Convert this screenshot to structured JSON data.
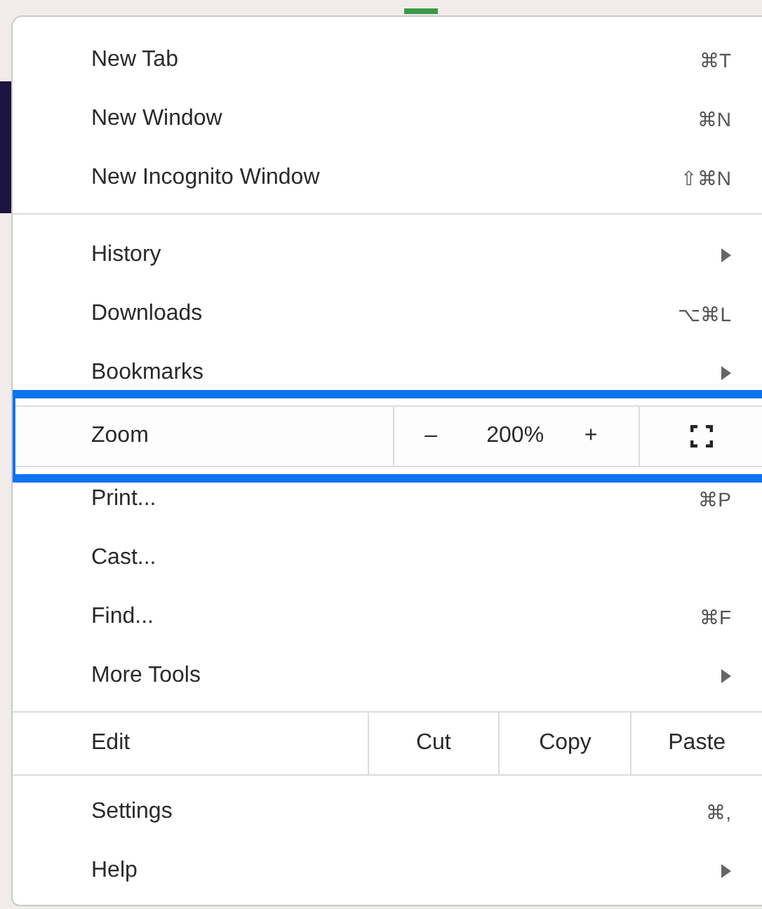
{
  "menu": {
    "sections": [
      {
        "items": [
          {
            "kind": "item",
            "label": "New Tab",
            "shortcut": "⌘T",
            "submenu": false
          },
          {
            "kind": "item",
            "label": "New Window",
            "shortcut": "⌘N",
            "submenu": false
          },
          {
            "kind": "item",
            "label": "New Incognito Window",
            "shortcut": "⇧⌘N",
            "submenu": false
          }
        ]
      },
      {
        "items": [
          {
            "kind": "item",
            "label": "History",
            "submenu": true
          },
          {
            "kind": "item",
            "label": "Downloads",
            "shortcut": "⌥⌘L",
            "submenu": false
          },
          {
            "kind": "item",
            "label": "Bookmarks",
            "submenu": true
          },
          {
            "kind": "zoom",
            "label": "Zoom",
            "minus": "–",
            "value": "200%",
            "plus": "+",
            "highlighted": true
          },
          {
            "kind": "item",
            "label": "Print...",
            "shortcut": "⌘P",
            "submenu": false
          },
          {
            "kind": "item",
            "label": "Cast...",
            "submenu": false
          },
          {
            "kind": "item",
            "label": "Find...",
            "shortcut": "⌘F",
            "submenu": false
          },
          {
            "kind": "item",
            "label": "More Tools",
            "submenu": true
          }
        ]
      },
      {
        "items": [
          {
            "kind": "edit",
            "label": "Edit",
            "actions": [
              "Cut",
              "Copy",
              "Paste"
            ]
          }
        ]
      },
      {
        "items": [
          {
            "kind": "item",
            "label": "Settings",
            "shortcut": "⌘,",
            "submenu": false
          },
          {
            "kind": "item",
            "label": "Help",
            "submenu": true
          }
        ]
      }
    ]
  }
}
